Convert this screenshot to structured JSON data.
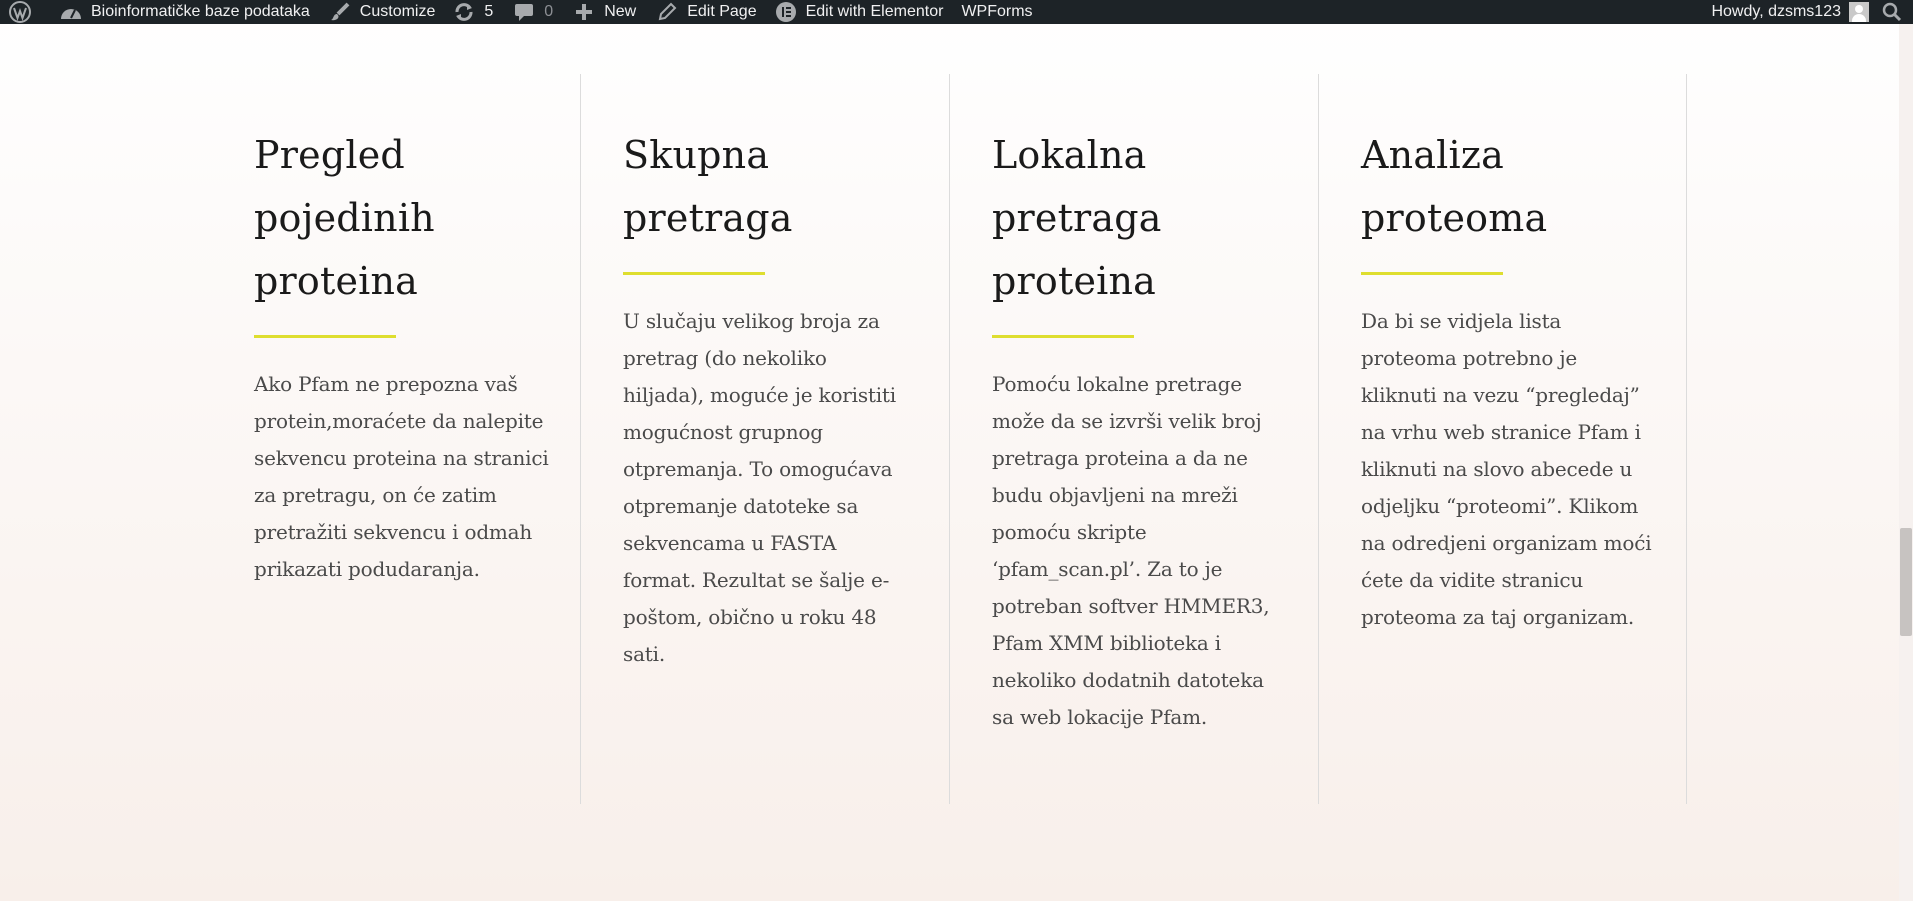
{
  "adminbar": {
    "site_name": "Bioinformatičke baze podataka",
    "customize": "Customize",
    "updates_count": "5",
    "comments_count": "0",
    "new": "New",
    "edit_page": "Edit Page",
    "edit_elementor": "Edit with Elementor",
    "wpforms": "WPForms",
    "howdy": "Howdy, dzsms123"
  },
  "columns": [
    {
      "title_lines": [
        "Pregled",
        "pojedinih",
        "proteina"
      ],
      "text": "Ako Pfam ne prepozna vaš protein,moraćete da nalepite sekvencu proteina na stranici za pretragu, on će zatim pretražiti sekvencu i odmah prikazati podudaranja."
    },
    {
      "title_lines": [
        "Skupna",
        "pretraga"
      ],
      "text": "U slučaju velikog broja za pretrag (do nekoliko hiljada), moguće je koristiti mogućnost grupnog otpremanja. To omogućava otpremanje datoteke sa sekvencama u FASTA format. Rezultat se šalje e-poštom, obično u roku 48 sati."
    },
    {
      "title_lines": [
        "Lokalna",
        "pretraga",
        "proteina"
      ],
      "text": "Pomoću lokalne pretrage može da se izvrši velik broj pretraga proteina a da ne budu objavljeni na mreži pomoću skripte ‘pfam_scan.pl’. Za to je potreban softver HMMER3, Pfam XMM biblioteka i nekoliko dodatnih datoteka sa web lokacije Pfam."
    },
    {
      "title_lines": [
        "Analiza",
        "proteoma"
      ],
      "text": "Da bi se vidjela lista proteoma potrebno je kliknuti na vezu “pregledaj” na vrhu web stranice Pfam i kliknuti na slovo abecede u odjeljku “proteomi”. Klikom na odredjeni organizam moći ćete da vidite stranicu proteoma za taj organizam."
    }
  ],
  "colors": {
    "accent_underline": "#dede2f",
    "adminbar_bg": "#1d2327"
  }
}
